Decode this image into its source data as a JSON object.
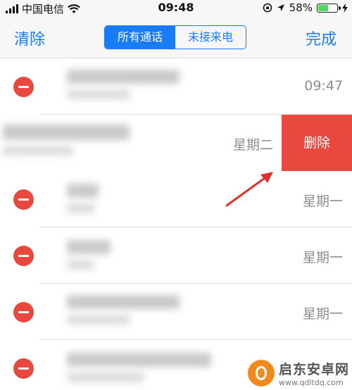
{
  "status_bar": {
    "carrier": "中国电信",
    "time": "09:48",
    "battery": "58%",
    "battery_level": 0.58
  },
  "nav": {
    "left_button": "清除",
    "right_button": "完成",
    "segments": [
      {
        "label": "所有通话",
        "active": true
      },
      {
        "label": "未接来电",
        "active": false
      }
    ]
  },
  "calls": [
    {
      "time": "09:47"
    },
    {
      "time": "星期二",
      "delete_label": "删除"
    },
    {
      "time": "星期一"
    },
    {
      "time": "星期一"
    },
    {
      "time": "星期一"
    },
    {
      "time": ""
    }
  ],
  "watermark": {
    "title": "启东安卓网",
    "url": "www.qdltdq.com"
  },
  "colors": {
    "accent": "#1a7cf5",
    "delete_red": "#e8483e",
    "time_gray": "#8e8e93"
  }
}
